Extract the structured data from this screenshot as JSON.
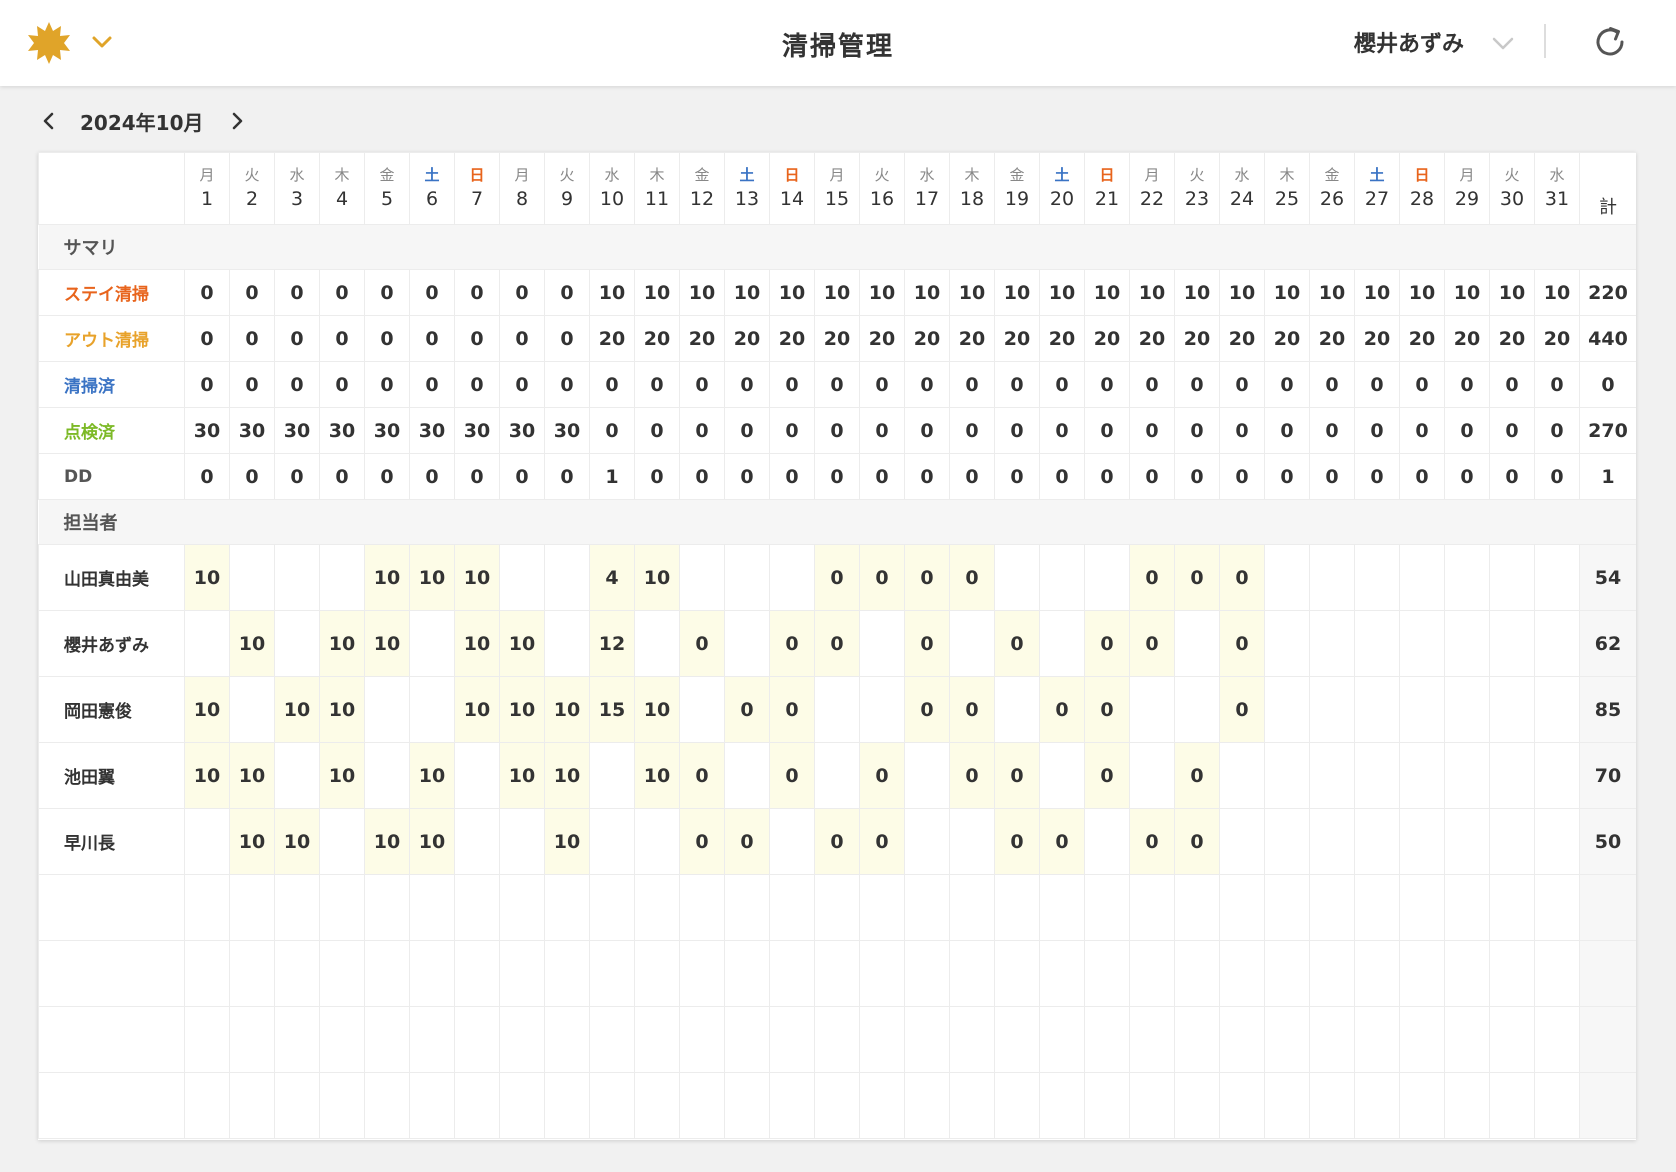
{
  "header": {
    "title": "清掃管理",
    "user": "櫻井あずみ",
    "colors": {
      "accent": "#e0a429",
      "stay": "#e8641c",
      "out": "#e8a22a",
      "cleaned": "#3a73c4",
      "inspected": "#7cb926"
    }
  },
  "month_nav": {
    "label": "2024年10月"
  },
  "table": {
    "total_header": "計",
    "days": [
      {
        "d": "1",
        "w": "月"
      },
      {
        "d": "2",
        "w": "火"
      },
      {
        "d": "3",
        "w": "水"
      },
      {
        "d": "4",
        "w": "木"
      },
      {
        "d": "5",
        "w": "金"
      },
      {
        "d": "6",
        "w": "土"
      },
      {
        "d": "7",
        "w": "日"
      },
      {
        "d": "8",
        "w": "月"
      },
      {
        "d": "9",
        "w": "火"
      },
      {
        "d": "10",
        "w": "水"
      },
      {
        "d": "11",
        "w": "木"
      },
      {
        "d": "12",
        "w": "金"
      },
      {
        "d": "13",
        "w": "土"
      },
      {
        "d": "14",
        "w": "日"
      },
      {
        "d": "15",
        "w": "月"
      },
      {
        "d": "16",
        "w": "火"
      },
      {
        "d": "17",
        "w": "水"
      },
      {
        "d": "18",
        "w": "木"
      },
      {
        "d": "19",
        "w": "金"
      },
      {
        "d": "20",
        "w": "土"
      },
      {
        "d": "21",
        "w": "日"
      },
      {
        "d": "22",
        "w": "月"
      },
      {
        "d": "23",
        "w": "火"
      },
      {
        "d": "24",
        "w": "水"
      },
      {
        "d": "25",
        "w": "木"
      },
      {
        "d": "26",
        "w": "金"
      },
      {
        "d": "27",
        "w": "土"
      },
      {
        "d": "28",
        "w": "日"
      },
      {
        "d": "29",
        "w": "月"
      },
      {
        "d": "30",
        "w": "火"
      },
      {
        "d": "31",
        "w": "水"
      }
    ],
    "summary_title": "サマリ",
    "summary_rows": [
      {
        "label": "ステイ清掃",
        "kind": "stay",
        "values": [
          "0",
          "0",
          "0",
          "0",
          "0",
          "0",
          "0",
          "0",
          "0",
          "10",
          "10",
          "10",
          "10",
          "10",
          "10",
          "10",
          "10",
          "10",
          "10",
          "10",
          "10",
          "10",
          "10",
          "10",
          "10",
          "10",
          "10",
          "10",
          "10",
          "10",
          "10"
        ],
        "total": "220"
      },
      {
        "label": "アウト清掃",
        "kind": "out",
        "values": [
          "0",
          "0",
          "0",
          "0",
          "0",
          "0",
          "0",
          "0",
          "0",
          "20",
          "20",
          "20",
          "20",
          "20",
          "20",
          "20",
          "20",
          "20",
          "20",
          "20",
          "20",
          "20",
          "20",
          "20",
          "20",
          "20",
          "20",
          "20",
          "20",
          "20",
          "20"
        ],
        "total": "440"
      },
      {
        "label": "清掃済",
        "kind": "cleaned",
        "values": [
          "0",
          "0",
          "0",
          "0",
          "0",
          "0",
          "0",
          "0",
          "0",
          "0",
          "0",
          "0",
          "0",
          "0",
          "0",
          "0",
          "0",
          "0",
          "0",
          "0",
          "0",
          "0",
          "0",
          "0",
          "0",
          "0",
          "0",
          "0",
          "0",
          "0",
          "0"
        ],
        "total": "0"
      },
      {
        "label": "点検済",
        "kind": "inspected",
        "values": [
          "30",
          "30",
          "30",
          "30",
          "30",
          "30",
          "30",
          "30",
          "30",
          "0",
          "0",
          "0",
          "0",
          "0",
          "0",
          "0",
          "0",
          "0",
          "0",
          "0",
          "0",
          "0",
          "0",
          "0",
          "0",
          "0",
          "0",
          "0",
          "0",
          "0",
          "0"
        ],
        "total": "270"
      },
      {
        "label": "DD",
        "kind": "dd",
        "values": [
          "0",
          "0",
          "0",
          "0",
          "0",
          "0",
          "0",
          "0",
          "0",
          "1",
          "0",
          "0",
          "0",
          "0",
          "0",
          "0",
          "0",
          "0",
          "0",
          "0",
          "0",
          "0",
          "0",
          "0",
          "0",
          "0",
          "0",
          "0",
          "0",
          "0",
          "0"
        ],
        "total": "1"
      }
    ],
    "staff_title": "担当者",
    "staff_rows": [
      {
        "name": "山田真由美",
        "values": [
          "10",
          "",
          "",
          "",
          "10",
          "10",
          "10",
          "",
          "",
          "4",
          "10",
          "",
          "",
          "",
          "0",
          "0",
          "0",
          "0",
          "",
          "",
          "",
          "0",
          "0",
          "0",
          "",
          "",
          "",
          "",
          "",
          "",
          ""
        ],
        "total": "54"
      },
      {
        "name": "櫻井あずみ",
        "values": [
          "",
          "10",
          "",
          "10",
          "10",
          "",
          "10",
          "10",
          "",
          "12",
          "",
          "0",
          "",
          "0",
          "0",
          "",
          "0",
          "",
          "0",
          "",
          "0",
          "0",
          "",
          "0",
          "",
          "",
          "",
          "",
          "",
          "",
          ""
        ],
        "total": "62"
      },
      {
        "name": "岡田憲俊",
        "values": [
          "10",
          "",
          "10",
          "10",
          "",
          "",
          "10",
          "10",
          "10",
          "15",
          "10",
          "",
          "0",
          "0",
          "",
          "",
          "0",
          "0",
          "",
          "0",
          "0",
          "",
          "",
          "0",
          "",
          "",
          "",
          "",
          "",
          "",
          ""
        ],
        "total": "85"
      },
      {
        "name": "池田翼",
        "values": [
          "10",
          "10",
          "",
          "10",
          "",
          "10",
          "",
          "10",
          "10",
          "",
          "10",
          "0",
          "",
          "0",
          "",
          "0",
          "",
          "0",
          "0",
          "",
          "0",
          "",
          "0",
          "",
          "",
          "",
          "",
          "",
          "",
          "",
          ""
        ],
        "total": "70"
      },
      {
        "name": "早川長",
        "values": [
          "",
          "10",
          "10",
          "",
          "10",
          "10",
          "",
          "",
          "10",
          "",
          "",
          "0",
          "0",
          "",
          "0",
          "0",
          "",
          "",
          "0",
          "0",
          "",
          "0",
          "0",
          "",
          "",
          "",
          "",
          "",
          "",
          "",
          ""
        ],
        "total": "50"
      }
    ],
    "empty_rows": 4
  }
}
